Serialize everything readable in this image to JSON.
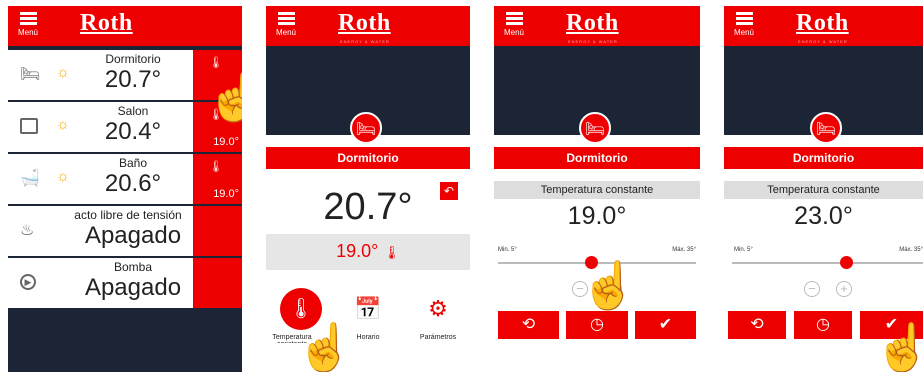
{
  "app": {
    "menu_label": "Menú",
    "logo": "Roth",
    "logo_sub": "ENERGY & WATER"
  },
  "screen1": {
    "rows": [
      {
        "name": "Dormitorio",
        "value": "20.7°",
        "setpoint": ""
      },
      {
        "name": "Salon",
        "value": "20.4°",
        "setpoint": "19.0°"
      },
      {
        "name": "Baño",
        "value": "20.6°",
        "setpoint": "19.0°"
      },
      {
        "name": "acto libre de tensión",
        "value": "Apagado",
        "setpoint": ""
      },
      {
        "name": "Bomba",
        "value": "Apagado",
        "setpoint": ""
      }
    ]
  },
  "screen2": {
    "room": "Dormitorio",
    "current": "20.7°",
    "setpoint": "19.0°",
    "tiles": [
      "Temperatura constante",
      "Horario",
      "Parámetros"
    ]
  },
  "screen3": {
    "room": "Dormitorio",
    "mode": "Temperatura constante",
    "value": "19.0°",
    "min": "Min. 5°",
    "max": "Máx. 35°",
    "slider_fraction": 0.47
  },
  "screen4": {
    "room": "Dormitorio",
    "mode": "Temperatura constante",
    "value": "23.0°",
    "min": "Min. 5°",
    "max": "Máx. 35°",
    "slider_fraction": 0.6
  },
  "colors": {
    "brand_red": "#ee0000",
    "dark_navy": "#1c2535"
  },
  "icons": [
    "hamburger-menu-icon",
    "bed-icon",
    "sun-icon",
    "thermometer-icon",
    "hand-pointer-icon",
    "back-icon",
    "clock-icon",
    "check-icon",
    "calendar-icon",
    "gears-icon"
  ]
}
